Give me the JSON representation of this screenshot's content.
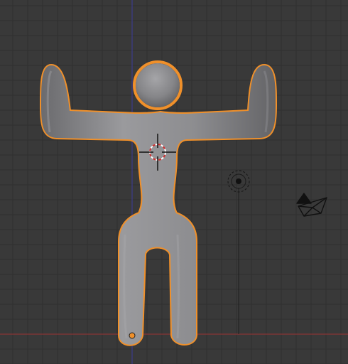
{
  "viewport": {
    "background_color": "#393939",
    "grid_color": "#2f2f2f",
    "x_axis_color": "#7a3535",
    "y_axis_color": "#3a3a7a"
  },
  "selected_object": {
    "kind": "mesh",
    "shape": "humanoid-figure-arms-raised",
    "body_color": "#8a8a8d",
    "outline_color": "#f0902a",
    "origin_color": "#f0902a"
  },
  "icons": {
    "cursor": "3d-cursor-icon",
    "lamp": "lamp-icon",
    "camera": "camera-icon"
  }
}
